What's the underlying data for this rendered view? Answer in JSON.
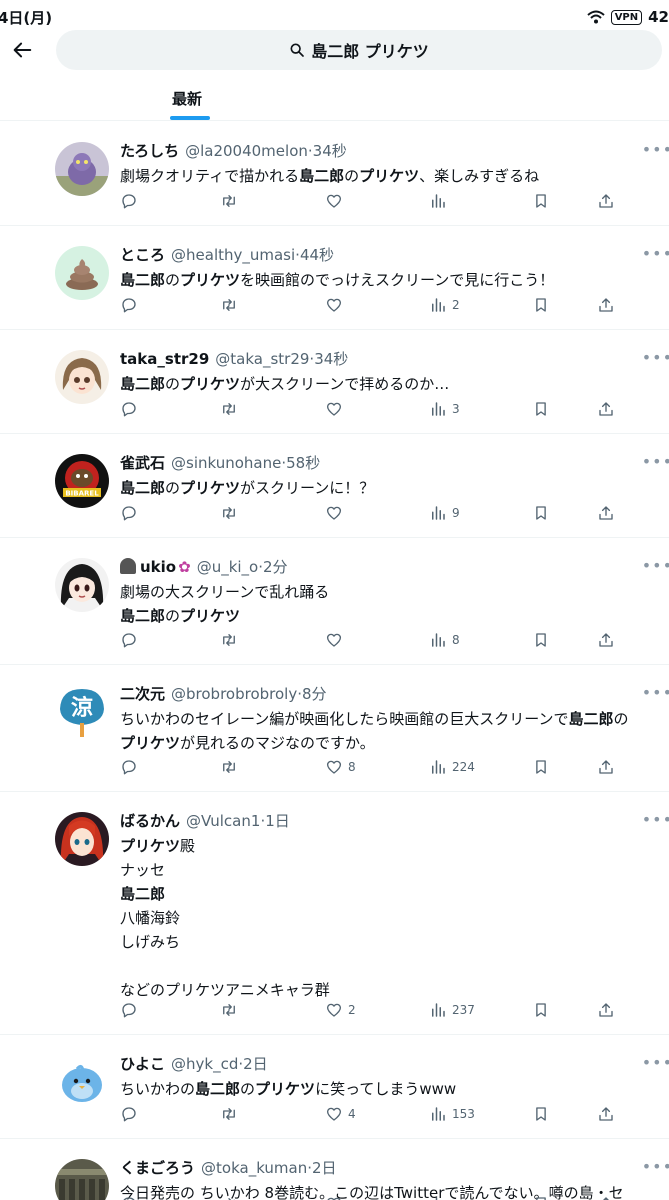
{
  "status": {
    "time": "4日(月)",
    "vpn": "VPN",
    "battery": "42"
  },
  "search": {
    "query": "島二郎 プリケツ"
  },
  "tabs": {
    "latest": "最新"
  },
  "tweets": [
    {
      "name": "たろしち",
      "handle": "@la20040melon",
      "time": "34秒",
      "lines": [
        [
          {
            "t": "劇場クオリティで描かれる"
          },
          {
            "t": "島二郎",
            "b": true
          },
          {
            "t": "の"
          },
          {
            "t": "プリケツ",
            "b": true
          },
          {
            "t": "、楽しみすぎるね"
          }
        ]
      ],
      "likes": "",
      "views": "",
      "avatar": "purple-creature"
    },
    {
      "name": "ところ",
      "handle": "@healthy_umasi",
      "time": "44秒",
      "lines": [
        [
          {
            "t": "島二郎",
            "b": true
          },
          {
            "t": "の"
          },
          {
            "t": "プリケツ",
            "b": true
          },
          {
            "t": "を映画館のでっけえスクリーンで見に行こう！"
          }
        ]
      ],
      "likes": "",
      "views": "2",
      "avatar": "poop"
    },
    {
      "name": "taka_str29",
      "handle": "@taka_str29",
      "time": "34秒",
      "lines": [
        [
          {
            "t": "島二郎",
            "b": true
          },
          {
            "t": "の"
          },
          {
            "t": "プリケツ",
            "b": true
          },
          {
            "t": "が大スクリーンで拝めるのか…"
          }
        ]
      ],
      "likes": "",
      "views": "3",
      "avatar": "anime-girl-brown"
    },
    {
      "name": "雀武石",
      "handle": "@sinkunohane",
      "time": "58秒",
      "lines": [
        [
          {
            "t": "島二郎",
            "b": true
          },
          {
            "t": "の"
          },
          {
            "t": "プリケツ",
            "b": true
          },
          {
            "t": "がスクリーンに！？"
          }
        ]
      ],
      "likes": "",
      "views": "9",
      "avatar": "bibarel"
    },
    {
      "name": "ukio",
      "handle": "@u_ki_o",
      "time": "2分",
      "lines": [
        [
          {
            "t": "劇場の大スクリーンで乱れ踊る"
          }
        ],
        [
          {
            "t": "島二郎",
            "b": true
          },
          {
            "t": "の"
          },
          {
            "t": "プリケツ",
            "b": true
          }
        ]
      ],
      "likes": "",
      "views": "8",
      "avatar": "anime-girl-black"
    },
    {
      "name": "二次元",
      "handle": "@brobrobrobroly",
      "time": "8分",
      "lines": [
        [
          {
            "t": "ちいかわのセイレーン編が映画化したら映画館の巨大スクリーンで"
          },
          {
            "t": "島二郎",
            "b": true
          },
          {
            "t": "の"
          }
        ],
        [
          {
            "t": "プリケツ",
            "b": true
          },
          {
            "t": "が見れるのマジなのですか。"
          }
        ]
      ],
      "likes": "8",
      "views": "224",
      "avatar": "ryo-fan"
    },
    {
      "name": "ばるかん",
      "handle": "@Vulcan1",
      "time": "1日",
      "lines": [
        [
          {
            "t": "プリケツ",
            "b": true
          },
          {
            "t": "殿"
          }
        ],
        [
          {
            "t": "ナッセ"
          }
        ],
        [
          {
            "t": "島二郎",
            "b": true
          }
        ],
        [
          {
            "t": "八幡海鈴"
          }
        ],
        [
          {
            "t": "しげみち"
          }
        ],
        [],
        [
          {
            "t": "などのプリケツアニメキャラ群"
          }
        ]
      ],
      "likes": "2",
      "views": "237",
      "avatar": "anime-girl-red"
    },
    {
      "name": "ひよこ",
      "handle": "@hyk_cd",
      "time": "2日",
      "lines": [
        [
          {
            "t": "ちいかわの"
          },
          {
            "t": "島二郎",
            "b": true
          },
          {
            "t": "の"
          },
          {
            "t": "プリケツ",
            "b": true
          },
          {
            "t": "に笑ってしまうwww"
          }
        ]
      ],
      "likes": "4",
      "views": "153",
      "avatar": "blue-bird"
    },
    {
      "name": "くまごろう",
      "handle": "@toka_kuman",
      "time": "2日",
      "lines": [
        [
          {
            "t": "今日発売の ちいかわ 8巻読む。この辺はTwitterで読んでない。噂の島・セ"
          }
        ]
      ],
      "likes": "",
      "views": "",
      "avatar": "photo"
    }
  ]
}
